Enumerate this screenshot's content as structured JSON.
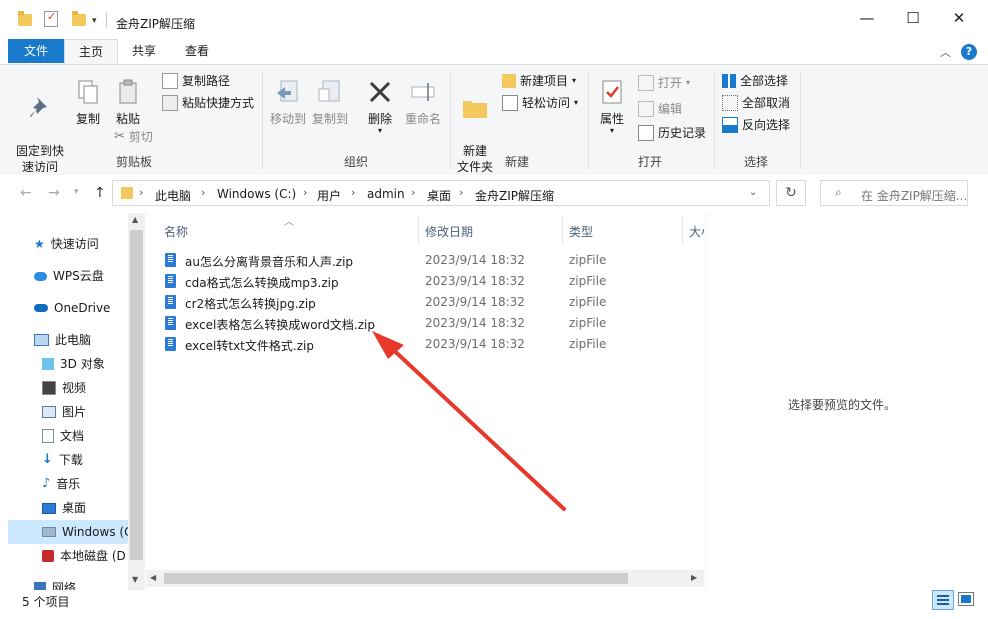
{
  "window": {
    "title": "金舟ZIP解压缩",
    "controls": {
      "minimize": "—",
      "maximize": "☐",
      "close": "✕"
    }
  },
  "ribbon_tabs": {
    "file": "文件",
    "home": "主页",
    "share": "共享",
    "view": "查看"
  },
  "ribbon": {
    "clipboard": {
      "pin": "固定到快\n速访问",
      "copy": "复制",
      "paste": "粘贴",
      "copy_path": "复制路径",
      "paste_shortcut": "粘贴快捷方式",
      "cut": "剪切",
      "group": "剪贴板"
    },
    "organize": {
      "move_to": "移动到",
      "copy_to": "复制到",
      "delete": "删除",
      "rename": "重命名",
      "group": "组织"
    },
    "new": {
      "new_folder": "新建\n文件夹",
      "new_item": "新建项目",
      "easy_access": "轻松访问",
      "group": "新建"
    },
    "open": {
      "properties": "属性",
      "open": "打开",
      "edit": "编辑",
      "history": "历史记录",
      "group": "打开"
    },
    "select": {
      "select_all": "全部选择",
      "select_none": "全部取消",
      "invert": "反向选择",
      "group": "选择"
    }
  },
  "address": {
    "crumbs": [
      "此电脑",
      "Windows (C:)",
      "用户",
      "admin",
      "桌面",
      "金舟ZIP解压缩"
    ],
    "search_placeholder": "在 金舟ZIP解压缩..."
  },
  "nav_pane": {
    "items": [
      {
        "label": "快速访问",
        "icon": "star-icon"
      },
      {
        "label": "WPS云盘",
        "icon": "cloud-icon"
      },
      {
        "label": "OneDrive",
        "icon": "onedrive-icon"
      },
      {
        "label": "此电脑",
        "icon": "pc-icon"
      },
      {
        "label": "3D 对象",
        "icon": "3d-icon"
      },
      {
        "label": "视频",
        "icon": "video-icon"
      },
      {
        "label": "图片",
        "icon": "picture-icon"
      },
      {
        "label": "文档",
        "icon": "document-icon"
      },
      {
        "label": "下载",
        "icon": "download-icon"
      },
      {
        "label": "音乐",
        "icon": "music-icon"
      },
      {
        "label": "桌面",
        "icon": "desktop-icon"
      },
      {
        "label": "Windows (C",
        "icon": "drive-icon"
      },
      {
        "label": "本地磁盘 (D",
        "icon": "disk-icon"
      },
      {
        "label": "网络",
        "icon": "network-icon"
      }
    ]
  },
  "file_list": {
    "columns": {
      "name": "名称",
      "date": "修改日期",
      "type": "类型",
      "size": "大小"
    },
    "files": [
      {
        "name": "au怎么分离背景音乐和人声.zip",
        "date": "2023/9/14 18:32",
        "type": "zipFile"
      },
      {
        "name": "cda格式怎么转换成mp3.zip",
        "date": "2023/9/14 18:32",
        "type": "zipFile"
      },
      {
        "name": "cr2格式怎么转换jpg.zip",
        "date": "2023/9/14 18:32",
        "type": "zipFile"
      },
      {
        "name": "excel表格怎么转换成word文档.zip",
        "date": "2023/9/14 18:32",
        "type": "zipFile"
      },
      {
        "name": "excel转txt文件格式.zip",
        "date": "2023/9/14 18:32",
        "type": "zipFile"
      }
    ]
  },
  "preview": {
    "message": "选择要预览的文件。"
  },
  "status": {
    "count": "5 个项目"
  },
  "colors": {
    "accent": "#1979ca",
    "arrow": "#e8382c"
  }
}
